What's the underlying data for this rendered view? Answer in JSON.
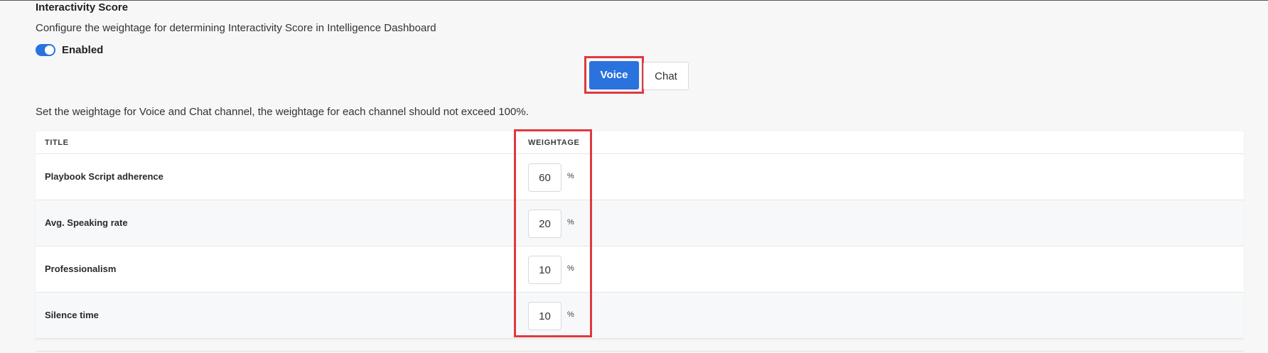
{
  "section": {
    "title": "Interactivity Score",
    "description": "Configure the weightage for determining Interactivity Score in Intelligence Dashboard",
    "toggle": {
      "label": "Enabled",
      "state": "on"
    }
  },
  "channels": {
    "tabs": [
      {
        "label": "Voice",
        "selected": true
      },
      {
        "label": "Chat",
        "selected": false
      }
    ]
  },
  "info_text": "Set the weightage for Voice and Chat channel, the weightage for each channel should not exceed 100%.",
  "table": {
    "headers": {
      "title": "TITLE",
      "weightage": "WEIGHTAGE"
    },
    "unit": "%",
    "rows": [
      {
        "title": "Playbook Script adherence",
        "weightage": "60"
      },
      {
        "title": "Avg. Speaking rate",
        "weightage": "20"
      },
      {
        "title": "Professionalism",
        "weightage": "10"
      },
      {
        "title": "Silence time",
        "weightage": "10"
      }
    ]
  },
  "colors": {
    "accent": "#2a72de",
    "highlight": "#e0393e"
  }
}
